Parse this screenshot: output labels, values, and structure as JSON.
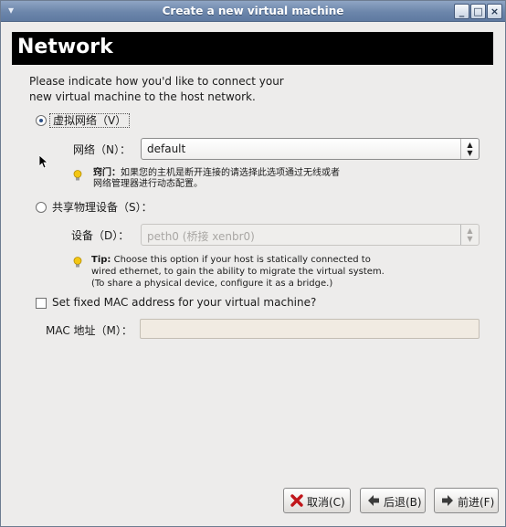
{
  "window": {
    "title": "Create a new virtual machine",
    "controls": [
      "_",
      "□",
      "×"
    ]
  },
  "header": {
    "title": "Network"
  },
  "intro": {
    "line1": "Please indicate how you'd like to connect your",
    "line2": "new virtual machine to the host network."
  },
  "virtual_network": {
    "option_label": "虚拟网络（V）",
    "selected": true,
    "network_label": "网络（N）：",
    "network_value": "default",
    "tip_heading": "窍门：",
    "tip_line1": "如果您的主机是断开连接的请选择此选项通过无线或者",
    "tip_line2": "网络管理器进行动态配置。"
  },
  "shared_device": {
    "option_label": "共享物理设备（S）：",
    "selected": false,
    "device_label": "设备（D）：",
    "device_value": "peth0 (桥接 xenbr0)",
    "tip_heading": "Tip:",
    "tip_line1": "Choose this option if your host is statically connected to",
    "tip_line2": "wired ethernet, to gain the ability to migrate the virtual system.",
    "tip_line3": "(To share a physical device, configure it as a bridge.)"
  },
  "mac": {
    "checkbox_label": "Set fixed MAC address for your virtual machine?",
    "checked": false,
    "field_label": "MAC 地址（M）：",
    "field_value": ""
  },
  "buttons": {
    "cancel": "取消(C)",
    "back": "后退(B)",
    "forward": "前进(F)"
  },
  "colors": {
    "titlebar": "#6c86ab",
    "header_band": "#000000",
    "window_bg": "#edeceb",
    "tip_bulb": "#f3c613"
  }
}
